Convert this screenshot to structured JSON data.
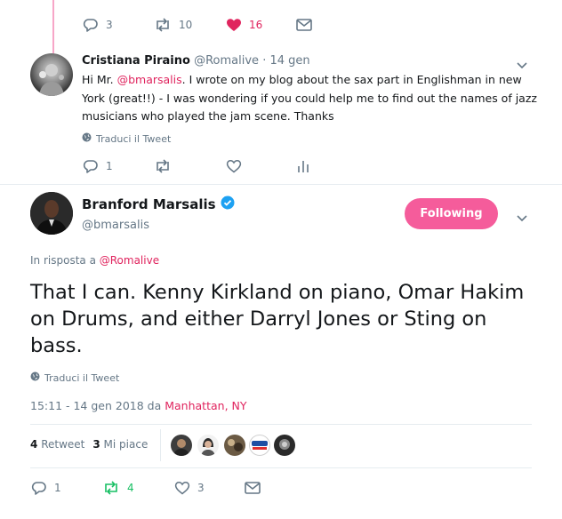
{
  "top_tweet": {
    "actions": {
      "replies": "3",
      "retweets": "10",
      "likes": "16"
    }
  },
  "reply_tweet": {
    "author_name": "Cristiana Piraino",
    "author_handle": "@Romalive",
    "separator": "·",
    "date": "14 gen",
    "text_pre": "Hi Mr. ",
    "mention": "@bmarsalis",
    "text_post": ".  I wrote on my blog about the sax part in Englishman in new York (great!!) - I was wondering if you could help me to find out the names of jazz musicians who played the jam scene. Thanks",
    "translate": "Traduci il Tweet",
    "actions": {
      "replies": "1"
    }
  },
  "main_tweet": {
    "author_name": "Branford Marsalis",
    "author_handle": "@bmarsalis",
    "follow_label": "Following",
    "reply_to_prefix": "In risposta a ",
    "reply_to_handle": "@Romalive",
    "text": "That I can. Kenny Kirkland on piano, Omar Hakim on Drums, and either Darryl Jones or Sting on bass.",
    "translate": "Traduci il Tweet",
    "timestamp": "15:11 - 14 gen 2018 da ",
    "location": "Manhattan, NY",
    "retweets_count": "4",
    "retweets_label": "Retweet",
    "likes_count": "3",
    "likes_label": "Mi piace",
    "actions": {
      "replies": "1",
      "retweets": "4",
      "likes": "3"
    }
  },
  "colors": {
    "accent": "#e0245e",
    "follow_button": "#f55c9b",
    "thread_line": "#f7a6c8",
    "retweet_green": "#17bf63",
    "verified_blue": "#1da1f2",
    "muted": "#657786"
  },
  "icons": [
    "reply-icon",
    "retweet-icon",
    "heart-icon",
    "envelope-icon",
    "chevron-down-icon",
    "globe-icon",
    "analytics-icon",
    "verified-badge-icon"
  ]
}
